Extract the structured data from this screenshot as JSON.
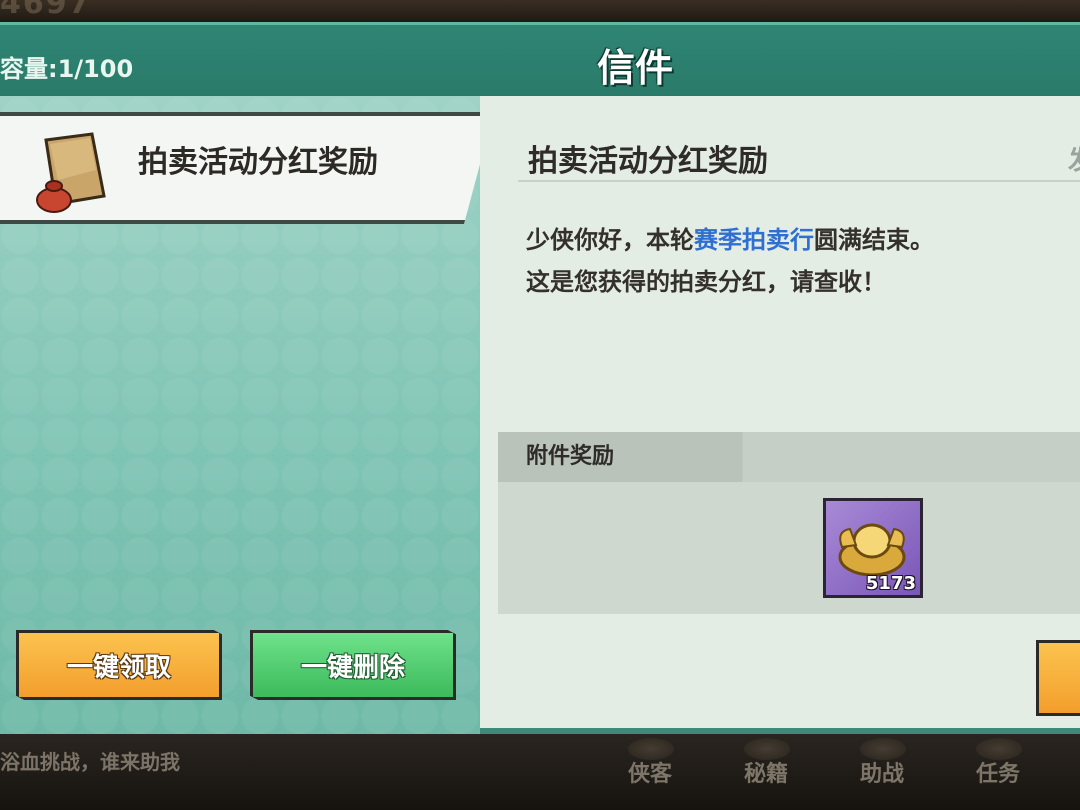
{
  "top": {
    "blurred_text": "4697"
  },
  "header": {
    "capacity": "容量:1/100",
    "title": "信件"
  },
  "mail_list": [
    {
      "title": "拍卖活动分红奖励",
      "icon": "envelope-with-pouch-icon"
    }
  ],
  "detail": {
    "title": "拍卖活动分红奖励",
    "date_partial": "发",
    "line1_prefix": "少侠你好，本轮",
    "line1_highlight": "赛季拍卖行",
    "line1_suffix": "圆满结束。",
    "line2": "这是您获得的拍卖分红，请查收！",
    "attachment_label": "附件奖励",
    "reward": {
      "icon": "gold-ingot-icon",
      "count": "5173"
    }
  },
  "buttons": {
    "claim_all": "一键领取",
    "delete_all": "一键删除"
  },
  "bottom": {
    "marquee": "浴血挑战，谁来助我",
    "nav": [
      "侠客",
      "秘籍",
      "助战",
      "任务"
    ]
  },
  "colors": {
    "header": "#2f8574",
    "highlight": "#2f6fd1",
    "claim": "#f39e2c",
    "delete": "#3cba5c",
    "reward_bg": "#7a56b8"
  }
}
